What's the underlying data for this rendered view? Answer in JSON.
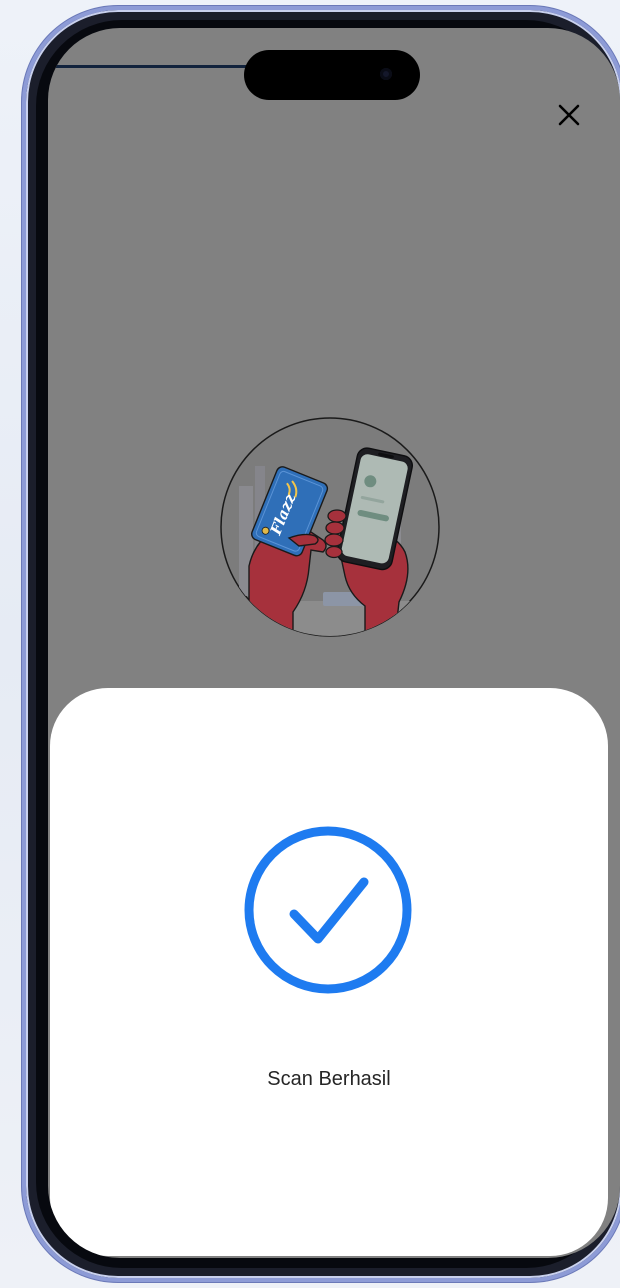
{
  "screen": {
    "background_overlay": "#818181",
    "close_icon": "close-icon"
  },
  "illustration": {
    "icon": "card-tap-phone-illustration",
    "card_brand": "Flazz",
    "card_color": "#2f6fb8",
    "hand_color": "#a6313c"
  },
  "result_sheet": {
    "status_icon": "check-circle-icon",
    "status_color": "#1e7bf0",
    "status_text": "Scan Berhasil"
  }
}
